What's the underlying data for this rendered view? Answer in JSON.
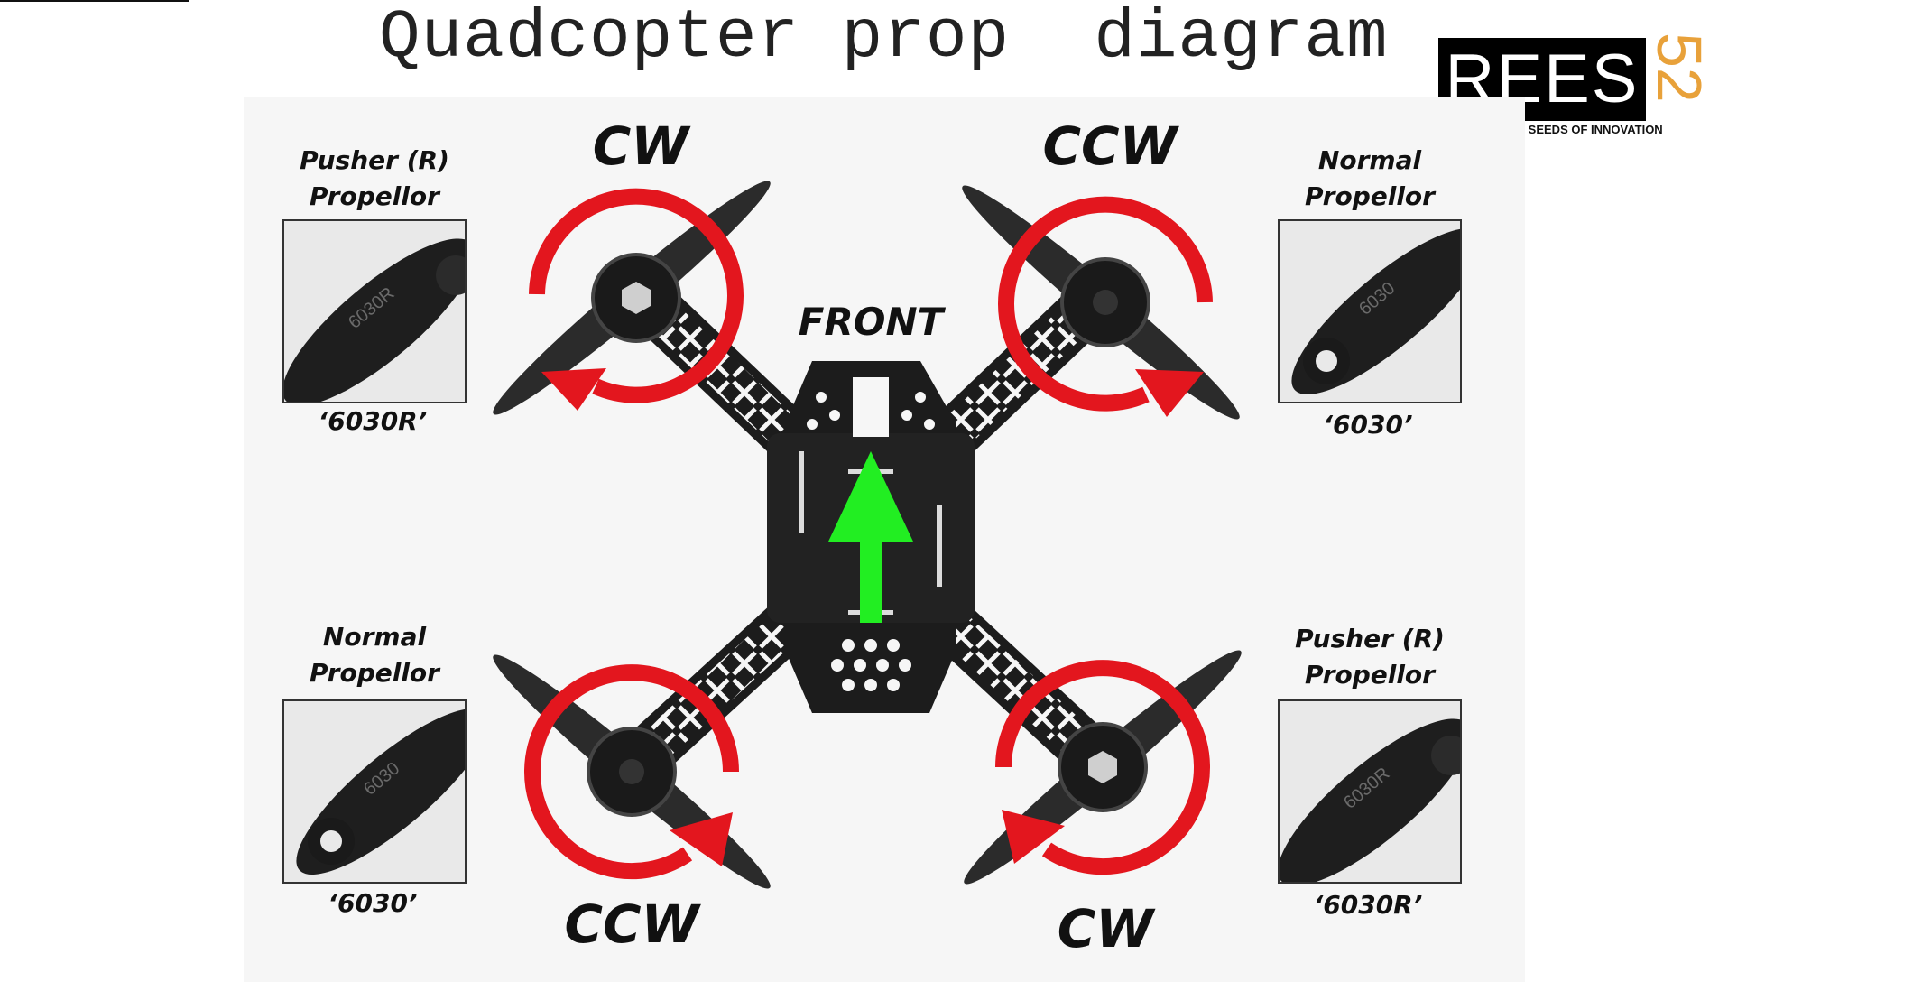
{
  "title": "Quadcopter prop  diagram",
  "logo": {
    "wordmark": "REES",
    "number": "52",
    "tagline": "PLANTING THE SEEDS OF INNOVATION",
    "accent_color": "#e8a13a"
  },
  "front_label": "FRONT",
  "motors": {
    "top_left": {
      "direction": "CW"
    },
    "top_right": {
      "direction": "CCW"
    },
    "bottom_left": {
      "direction": "CCW"
    },
    "bottom_right": {
      "direction": "CW"
    }
  },
  "props": {
    "top_left": {
      "type_line1": "Pusher (R)",
      "type_line2": "Propellor",
      "code": "‘6030R’",
      "engraving": "6030R"
    },
    "top_right": {
      "type_line1": "Normal",
      "type_line2": "Propellor",
      "code": "‘6030’",
      "engraving": "6030"
    },
    "bottom_left": {
      "type_line1": "Normal",
      "type_line2": "Propellor",
      "code": "‘6030’",
      "engraving": "6030"
    },
    "bottom_right": {
      "type_line1": "Pusher (R)",
      "type_line2": "Propellor",
      "code": "‘6030R’",
      "engraving": "6030R"
    }
  },
  "colors": {
    "rotation_arrow": "#e3161e",
    "front_arrow": "#22ee22",
    "frame": "#1c1c1c"
  }
}
